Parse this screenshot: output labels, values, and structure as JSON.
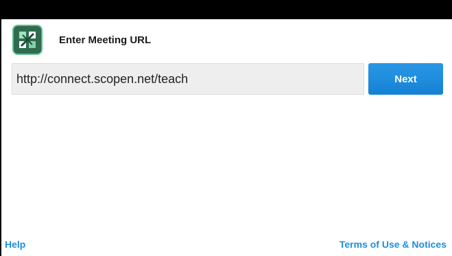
{
  "header": {
    "title": "Enter Meeting URL",
    "app_icon": "adobe-connect-logo"
  },
  "url_field": {
    "value": "http://connect.scopen.net/teach",
    "placeholder": ""
  },
  "next_button": {
    "label": "Next"
  },
  "footer": {
    "help_label": "Help",
    "terms_label": "Terms of Use & Notices"
  },
  "colors": {
    "accent": "#1a8fe0",
    "button": "#1f8ce0",
    "field_bg": "#eeeeee",
    "icon_bg": "#2f6b4f"
  }
}
